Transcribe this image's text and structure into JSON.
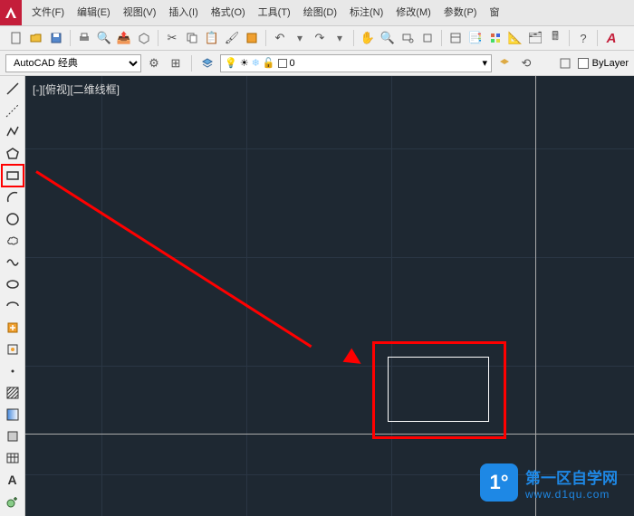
{
  "menus": {
    "file": "文件(F)",
    "edit": "编辑(E)",
    "view": "视图(V)",
    "insert": "插入(I)",
    "format": "格式(O)",
    "tools": "工具(T)",
    "draw": "绘图(D)",
    "dimension": "标注(N)",
    "modify": "修改(M)",
    "parametric": "参数(P)",
    "window": "窗"
  },
  "workspace": {
    "selected": "AutoCAD 经典"
  },
  "layer": {
    "current": "0",
    "bylayer_label": "ByLayer"
  },
  "viewport_label": "[-][俯视][二维线框]",
  "watermark": {
    "title": "第一区自学网",
    "url": "www.d1qu.com"
  },
  "colors": {
    "highlight": "#ff0000",
    "canvas_bg": "#1e2832",
    "brand": "#1e88e5"
  }
}
